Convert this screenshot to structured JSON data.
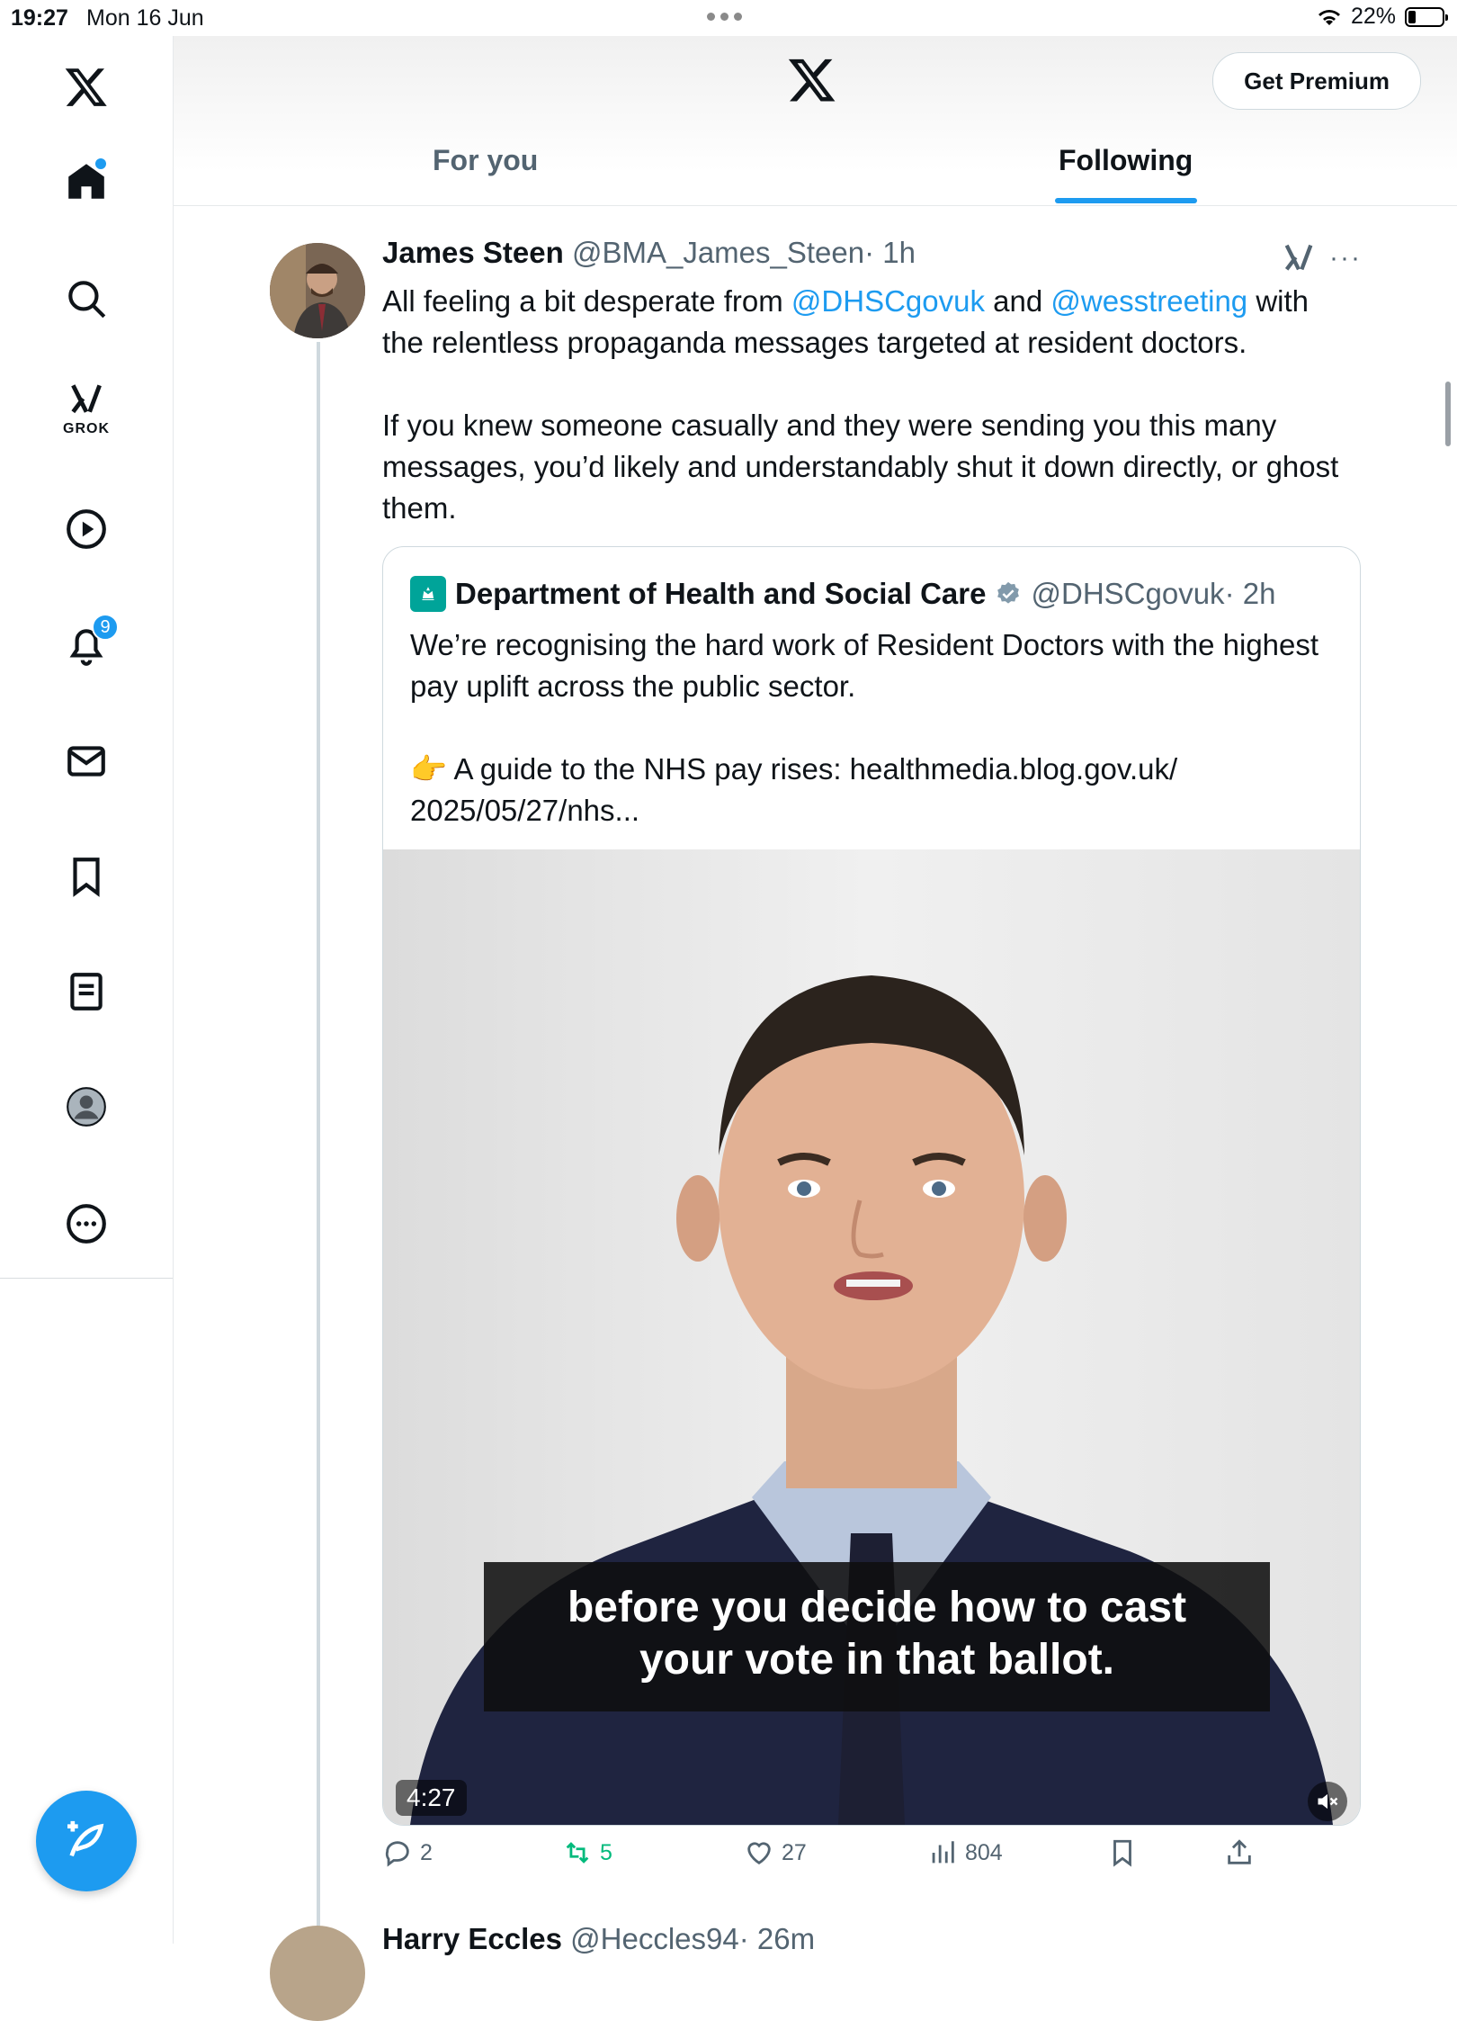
{
  "status_bar": {
    "time": "19:27",
    "date": "Mon 16 Jun",
    "battery": "22%"
  },
  "sidebar": {
    "items": [
      {
        "name": "home",
        "icon": "home-icon"
      },
      {
        "name": "search",
        "icon": "search-icon"
      },
      {
        "name": "grok",
        "icon": "grok-icon",
        "label": "GROK"
      },
      {
        "name": "video",
        "icon": "play-icon"
      },
      {
        "name": "notifications",
        "icon": "bell-icon",
        "badge": "9"
      },
      {
        "name": "messages",
        "icon": "mail-icon"
      },
      {
        "name": "bookmarks",
        "icon": "bookmark-icon"
      },
      {
        "name": "lists",
        "icon": "list-icon"
      },
      {
        "name": "profile",
        "icon": "profile-icon"
      },
      {
        "name": "more",
        "icon": "more-icon"
      }
    ]
  },
  "header": {
    "premium_label": "Get Premium",
    "tabs": [
      {
        "label": "For you"
      },
      {
        "label": "Following",
        "active": true
      }
    ]
  },
  "tweet": {
    "name": "James Steen",
    "handle": "@BMA_James_Steen",
    "time": "· 1h",
    "text1_a": "All feeling a bit desperate from ",
    "mention1": "@DHSCgovuk",
    "text1_b": " and ",
    "mention2": "@wesstreeting",
    "text1_c": " with the relentless propaganda messages targeted at resident doctors.",
    "text2": "If you knew someone casually and they were sending you this many messages, you’d likely and understandably shut it down directly, or ghost them.",
    "quoted": {
      "name": "Department of Health and Social Care",
      "handle": "@DHSCgovuk",
      "time": "· 2h",
      "text1": "We’re recognising the hard work of Resident Doctors with the highest pay uplift across the public sector.",
      "text2_emoji": "👉",
      "text2": " A guide to the NHS pay rises: healthmedia.blog.gov.uk/ 2025/05/27/nhs...",
      "video": {
        "caption_line1": "before you decide how to cast",
        "caption_line2": "your vote in that ballot.",
        "duration": "4:27"
      }
    },
    "actions": {
      "replies": "2",
      "reposts": "5",
      "likes": "27",
      "views": "804"
    }
  },
  "next_tweet": {
    "name": "Harry Eccles",
    "handle": "@Heccles94",
    "time": "· 26m"
  },
  "colors": {
    "accent": "#1d9bf0",
    "repost": "#00ba7c",
    "muted": "#536471"
  }
}
